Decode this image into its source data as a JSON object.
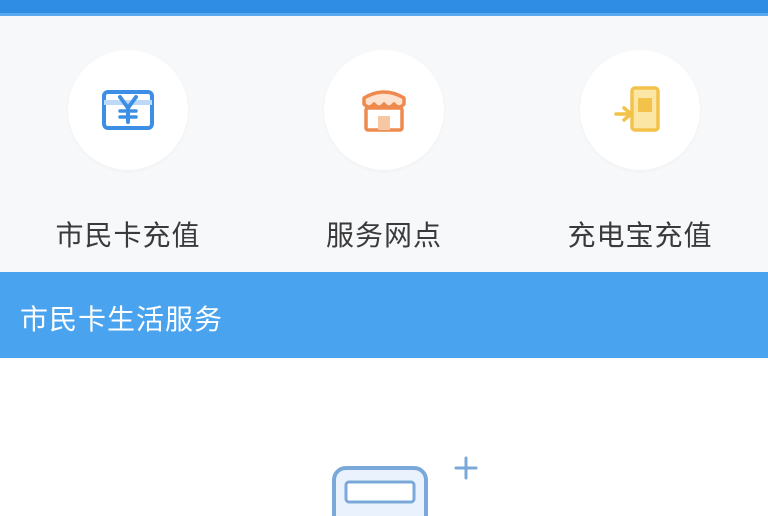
{
  "services": {
    "items": [
      {
        "label": "市民卡充值",
        "icon": "card-yuan-icon"
      },
      {
        "label": "服务网点",
        "icon": "storefront-icon"
      },
      {
        "label": "充电宝充值",
        "icon": "power-bank-icon"
      }
    ]
  },
  "life_services": {
    "title": "市民卡生活服务"
  },
  "empty_state": {
    "icon": "add-card-illustration-icon"
  },
  "colors": {
    "primary": "#2f8de4",
    "section_header": "#4aa3ef",
    "card_blue": "#3d8fe6",
    "store_orange": "#ee8a4e",
    "powerbank_yellow": "#f3c24b"
  }
}
